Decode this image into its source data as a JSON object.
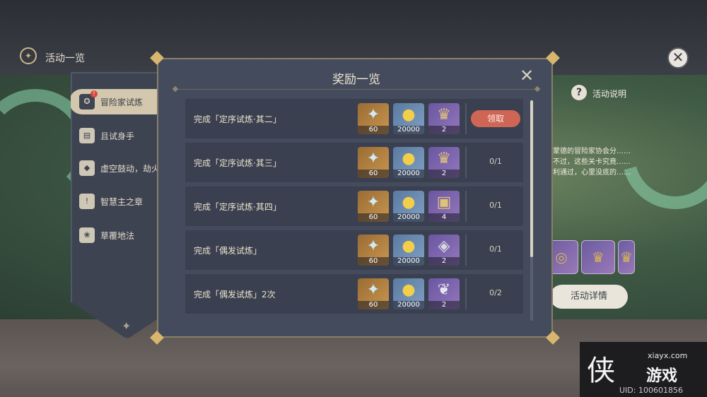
{
  "header": {
    "title": "活动一览",
    "title_icon": "compass-icon",
    "close_icon": "close-icon"
  },
  "sidebar": {
    "items": [
      {
        "label": "冒险家试炼",
        "icon": "adventurer-icon",
        "active": true,
        "badge": "!"
      },
      {
        "label": "且试身手",
        "icon": "cards-icon",
        "active": false
      },
      {
        "label": "虚空鼓动，劫火",
        "icon": "void-icon",
        "active": false
      },
      {
        "label": "智慧主之章",
        "icon": "wisdom-icon",
        "active": false
      },
      {
        "label": "草覆地法",
        "icon": "grass-icon",
        "active": false
      }
    ]
  },
  "right_panel": {
    "help_label": "活动说明",
    "description": "蒙德的冒险家协会分……不过，这些关卡究竟……利通过，心里没底的……",
    "detail_button": "活动详情"
  },
  "modal": {
    "title": "奖励一览",
    "rows": [
      {
        "label": "完成「定序试炼·其二」",
        "rewards": [
          {
            "icon": "primogem-icon",
            "qty": "60",
            "rarity": "gold"
          },
          {
            "icon": "mora-icon",
            "qty": "20000",
            "rarity": "blue"
          },
          {
            "icon": "crown-material-icon",
            "qty": "2",
            "rarity": "purple"
          }
        ],
        "action": "claim",
        "claim_label": "领取"
      },
      {
        "label": "完成「定序试炼·其三」",
        "rewards": [
          {
            "icon": "primogem-icon",
            "qty": "60",
            "rarity": "gold"
          },
          {
            "icon": "mora-icon",
            "qty": "20000",
            "rarity": "blue"
          },
          {
            "icon": "crown-material-icon",
            "qty": "2",
            "rarity": "purple"
          }
        ],
        "action": "progress",
        "progress": "0/1"
      },
      {
        "label": "完成「定序试炼·其四」",
        "rewards": [
          {
            "icon": "primogem-icon",
            "qty": "60",
            "rarity": "gold"
          },
          {
            "icon": "mora-icon",
            "qty": "20000",
            "rarity": "blue"
          },
          {
            "icon": "book-material-icon",
            "qty": "4",
            "rarity": "purple"
          }
        ],
        "action": "progress",
        "progress": "0/1"
      },
      {
        "label": "完成「偶发试炼」",
        "rewards": [
          {
            "icon": "primogem-icon",
            "qty": "60",
            "rarity": "gold"
          },
          {
            "icon": "mora-icon",
            "qty": "20000",
            "rarity": "blue"
          },
          {
            "icon": "mask-material-icon",
            "qty": "2",
            "rarity": "purple"
          }
        ],
        "action": "progress",
        "progress": "0/1"
      },
      {
        "label": "完成「偶发试炼」2次",
        "rewards": [
          {
            "icon": "primogem-icon",
            "qty": "60",
            "rarity": "gold"
          },
          {
            "icon": "mora-icon",
            "qty": "20000",
            "rarity": "blue"
          },
          {
            "icon": "mist-material-icon",
            "qty": "2",
            "rarity": "purple"
          }
        ],
        "action": "progress",
        "progress": "0/2"
      }
    ]
  },
  "watermark": {
    "domain": "xiayx.com",
    "name": "游戏",
    "logo_char": "侠",
    "uid": "UID: 100601856"
  },
  "colors": {
    "claim_button": "#cf6555",
    "modal_bg": "#444b5c",
    "accent_gold": "#d9b66e"
  }
}
